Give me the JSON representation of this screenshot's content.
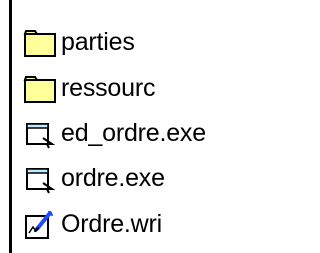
{
  "files": [
    {
      "name": "parties",
      "icon": "folder-icon"
    },
    {
      "name": "ressourc",
      "icon": "folder-icon"
    },
    {
      "name": "ed_ordre.exe",
      "icon": "application-icon"
    },
    {
      "name": "ordre.exe",
      "icon": "application-icon"
    },
    {
      "name": "Ordre.wri",
      "icon": "write-document-icon"
    }
  ],
  "colors": {
    "folder_fill": "#ffff99",
    "folder_stroke": "#000000",
    "app_fill": "#c0e8ff",
    "pen_blue": "#1e4bff"
  }
}
